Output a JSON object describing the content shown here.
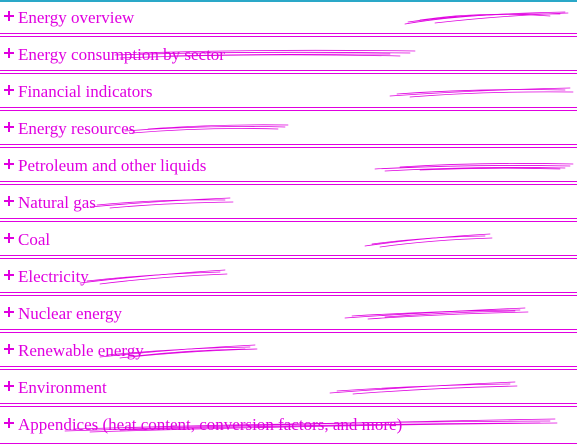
{
  "menu": {
    "items": [
      {
        "label": "Energy overview"
      },
      {
        "label": "Energy consumption by sector"
      },
      {
        "label": "Financial indicators"
      },
      {
        "label": "Energy resources"
      },
      {
        "label": "Petroleum and other liquids"
      },
      {
        "label": "Natural gas"
      },
      {
        "label": "Coal"
      },
      {
        "label": "Electricity"
      },
      {
        "label": "Nuclear energy"
      },
      {
        "label": "Renewable energy"
      },
      {
        "label": "Environment"
      },
      {
        "label": "Appendices (heat content, conversion factors, and more)"
      }
    ]
  },
  "colors": {
    "accent": "#e000e0",
    "top_rule": "#2aa8c8"
  },
  "icons": {
    "expand": "plus-icon"
  }
}
